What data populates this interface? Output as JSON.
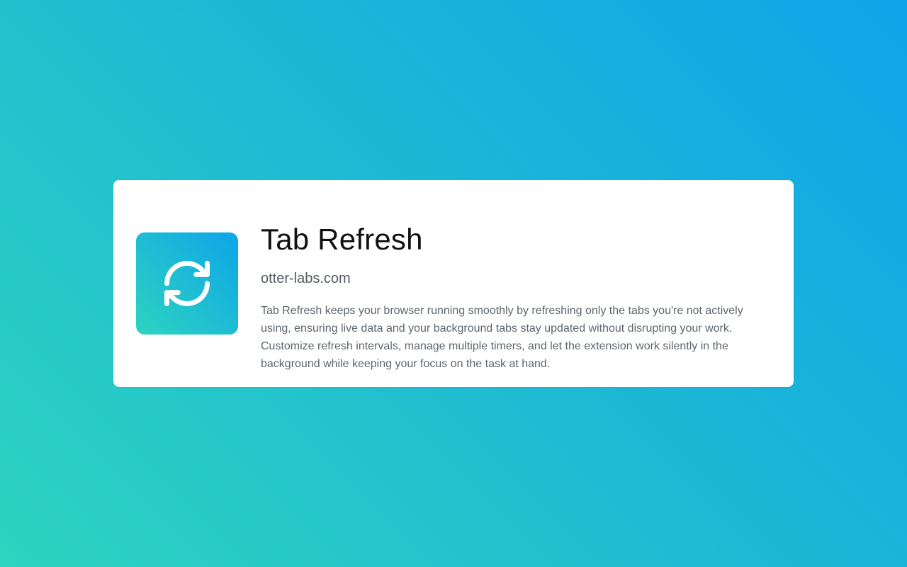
{
  "extension": {
    "name": "Tab Refresh",
    "domain": "otter-labs.com",
    "description": "Tab Refresh keeps your browser running smoothly by refreshing only the tabs you're not actively using, ensuring live data and your background tabs stay updated without disrupting your work. Customize refresh intervals, manage multiple timers, and let the extension work silently in the background while keeping your focus on the task at hand.",
    "icon": "refresh-icon"
  },
  "colors": {
    "gradient_start": "#0ea5e9",
    "gradient_end": "#2dd4bf",
    "card_background": "#ffffff",
    "title_text": "#111111",
    "secondary_text": "#5f666d"
  }
}
